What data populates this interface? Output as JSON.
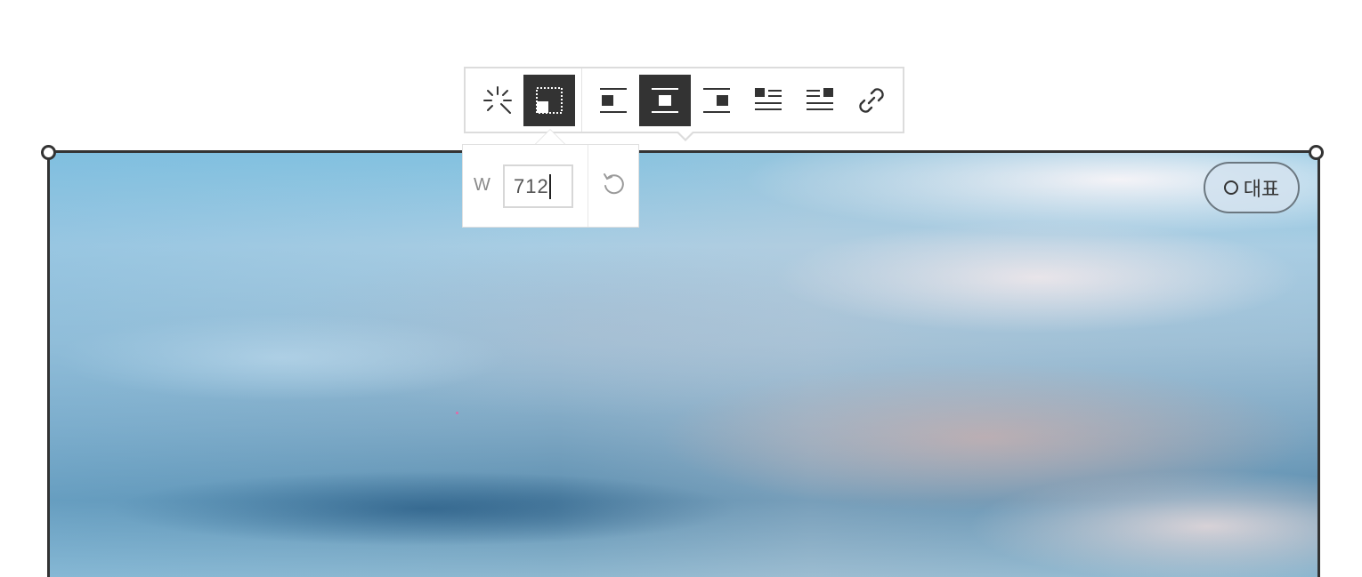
{
  "toolbar": {
    "buttons": [
      {
        "name": "auto-enhance",
        "icon": "sparkle-icon",
        "active": false
      },
      {
        "name": "resize",
        "icon": "resize-icon",
        "active": true
      },
      {
        "name": "align-left",
        "icon": "align-left-icon",
        "active": false
      },
      {
        "name": "align-center",
        "icon": "align-center-icon",
        "active": true
      },
      {
        "name": "align-right",
        "icon": "align-right-icon",
        "active": false
      },
      {
        "name": "wrap-left",
        "icon": "wrap-left-icon",
        "active": false
      },
      {
        "name": "wrap-right",
        "icon": "wrap-right-icon",
        "active": false
      },
      {
        "name": "link",
        "icon": "link-icon",
        "active": false
      }
    ]
  },
  "size_popover": {
    "width_label": "W",
    "width_value": "712",
    "reset_icon": "reset-icon"
  },
  "image": {
    "representative_badge": "대표",
    "badge_icon": "circle-icon"
  },
  "colors": {
    "active_button": "#333333",
    "frame_border": "#333333",
    "toolbar_border": "#dcdcdc"
  }
}
